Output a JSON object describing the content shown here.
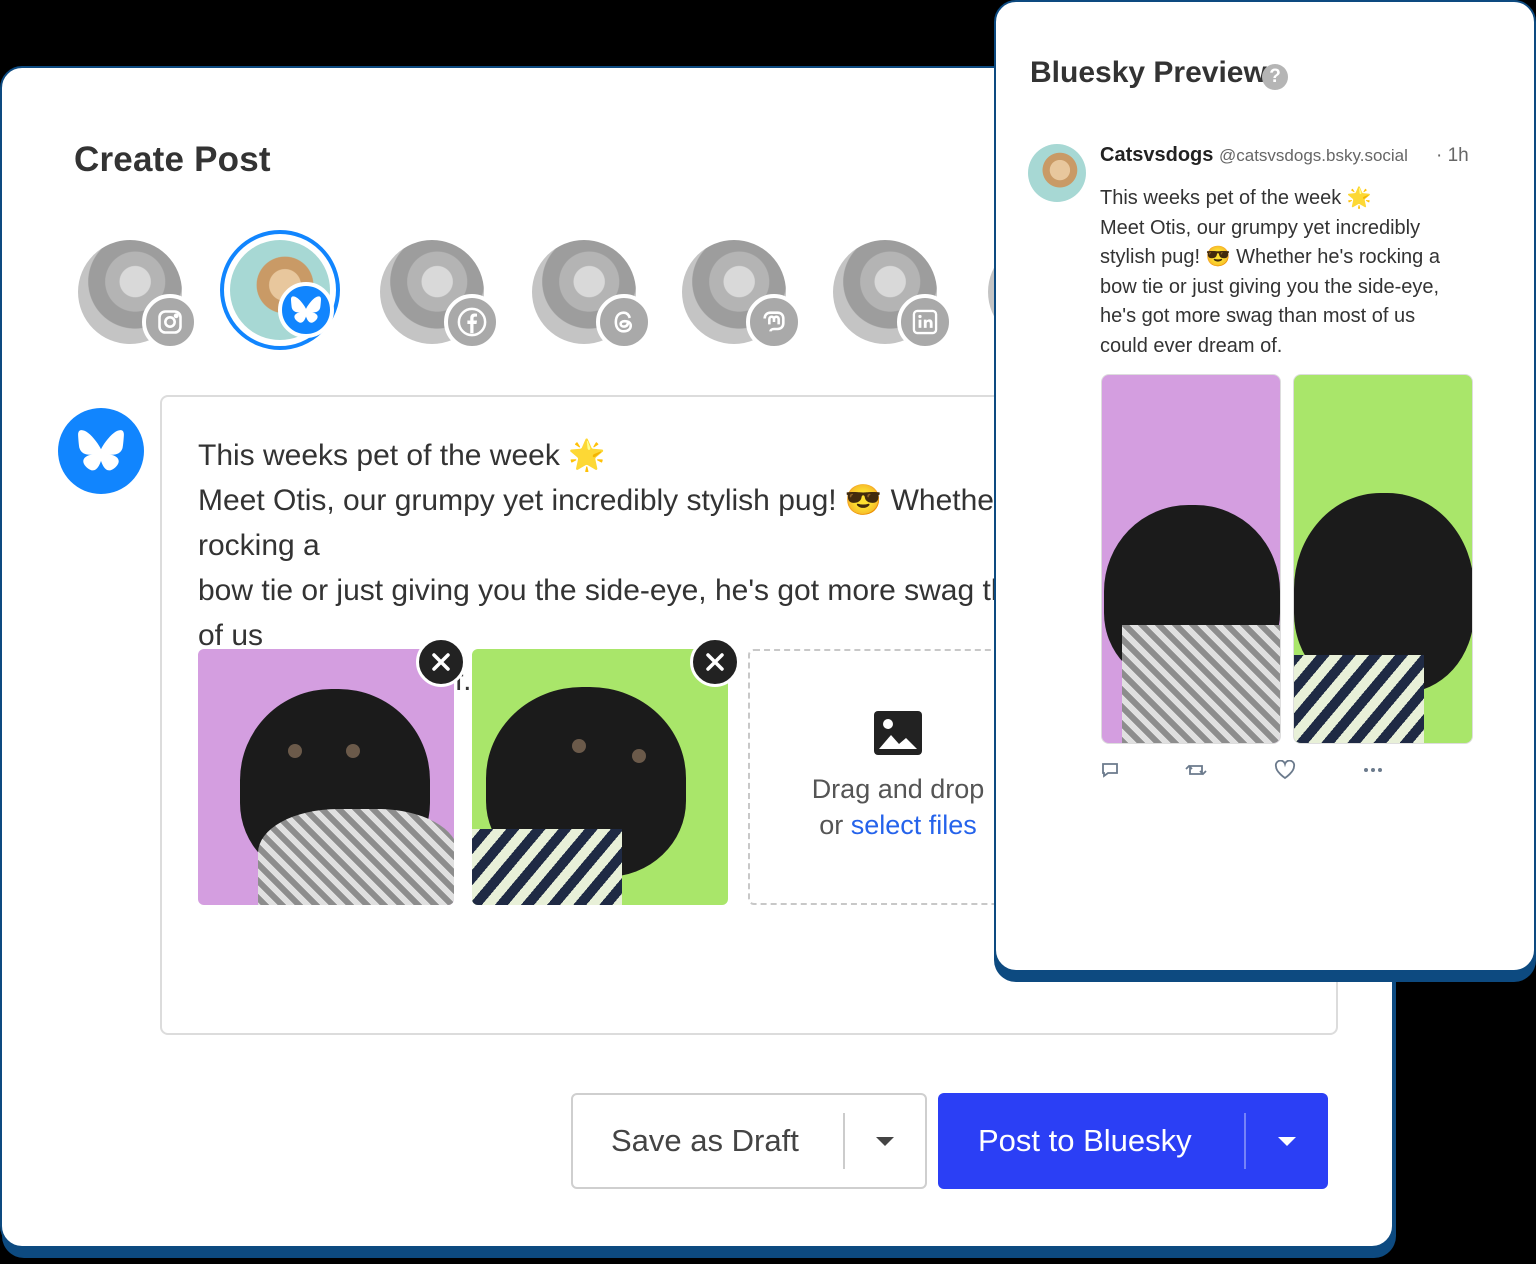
{
  "create_post": {
    "title": "Create Post",
    "accounts": [
      {
        "network": "instagram",
        "icon": "instagram-icon",
        "selected": false
      },
      {
        "network": "bluesky",
        "icon": "butterfly-icon",
        "selected": true
      },
      {
        "network": "facebook",
        "icon": "facebook-icon",
        "selected": false
      },
      {
        "network": "threads",
        "icon": "threads-icon",
        "selected": false
      },
      {
        "network": "mastodon",
        "icon": "mastodon-icon",
        "selected": false
      },
      {
        "network": "linkedin",
        "icon": "linkedin-icon",
        "selected": false
      }
    ],
    "post_text": "This weeks pet of the week 🌟\nMeet Otis, our grumpy yet incredibly stylish pug! 😎 Whether he's rocking a\nbow tie or just giving you the side-eye, he's got more swag than most of us\ncould ever dream of.",
    "dropzone": {
      "line1": "Drag and drop",
      "line2_prefix": "or ",
      "link": "select files"
    },
    "save_draft_label": "Save as Draft",
    "post_button_label": "Post to Bluesky",
    "colors": {
      "accent": "#2b3ff5",
      "bluesky": "#1185fe",
      "frame": "#0d4a80",
      "thumb1_bg": "#d49ee0",
      "thumb2_bg": "#a9e66a"
    }
  },
  "preview": {
    "title": "Bluesky Preview",
    "help_glyph": "?",
    "display_name": "Catsvsdogs",
    "handle": "@catsvsdogs.bsky.social",
    "time": "· 1h",
    "text": "This weeks pet of the week 🌟\nMeet Otis, our grumpy yet incredibly\nstylish pug! 😎 Whether he's rocking a\nbow tie or just giving you the side-eye,\nhe's got more swag than most of us\ncould ever dream of.",
    "actions": [
      "reply-icon",
      "repost-icon",
      "like-icon",
      "more-icon"
    ]
  }
}
